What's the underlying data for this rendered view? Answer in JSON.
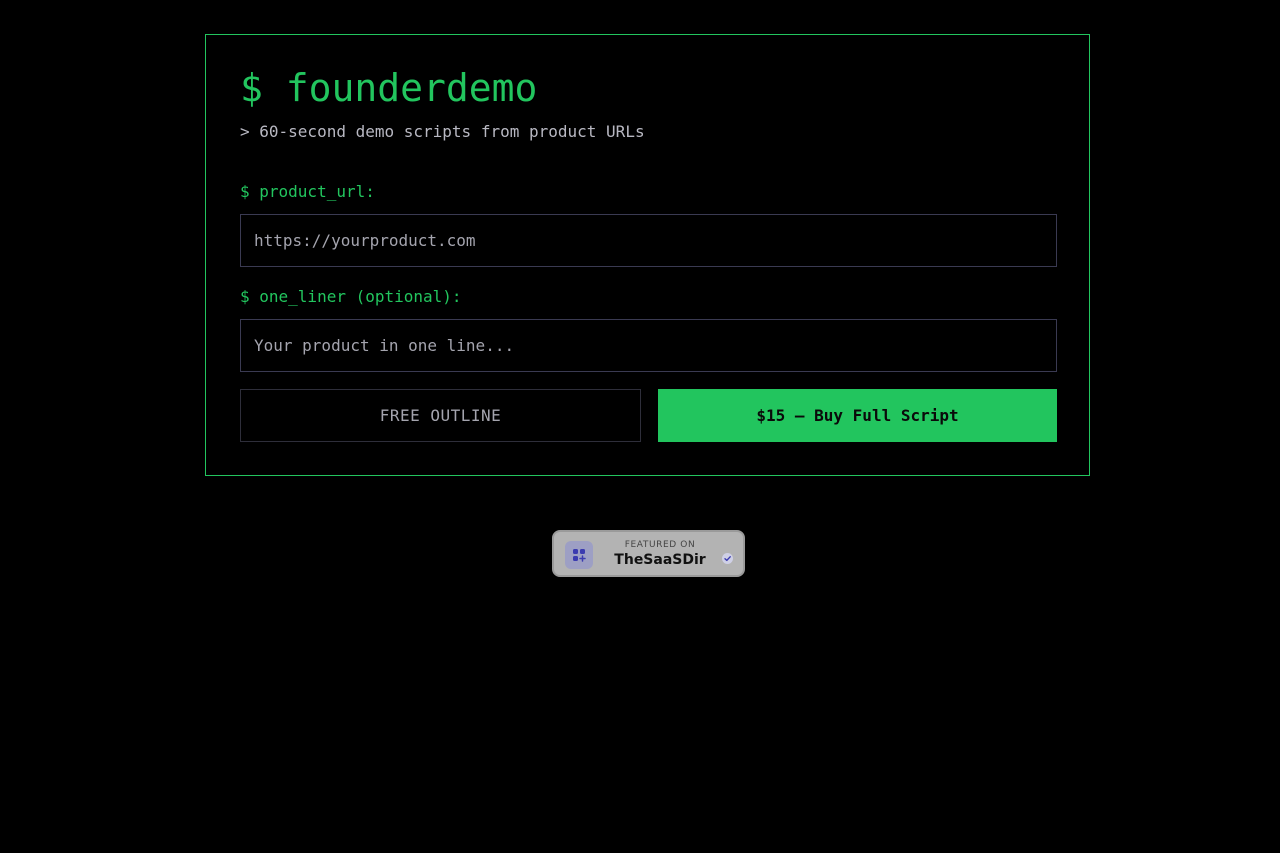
{
  "app": {
    "title": "$ founderdemo",
    "tagline": "> 60-second demo scripts from product URLs"
  },
  "form": {
    "url_label": "$ product_url:",
    "url_placeholder": "https://yourproduct.com",
    "url_value": "",
    "liner_label": "$ one_liner (optional):",
    "liner_placeholder": "Your product in one line...",
    "liner_value": ""
  },
  "actions": {
    "free_label": "FREE OUTLINE",
    "buy_label": "$15 — Buy Full Script"
  },
  "badge": {
    "featured_text": "FEATURED ON",
    "site_name": "TheSaaSDir",
    "logo_icon": "grid-plus-icon",
    "check_icon": "verified-check-icon"
  },
  "colors": {
    "accent": "#22c55e",
    "background": "#000000",
    "muted_text": "#b8b8c2",
    "input_border": "#3a3a52",
    "badge_bg": "#b3b3b3",
    "badge_logo": "#3b3bb0"
  }
}
